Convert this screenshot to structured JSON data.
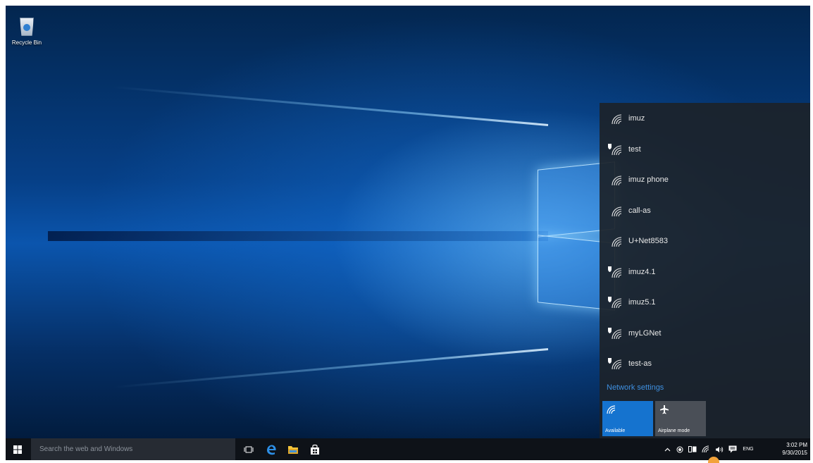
{
  "desktop": {
    "recycle_bin_label": "Recycle Bin"
  },
  "network_flyout": {
    "networks": [
      {
        "name": "imuz",
        "secured": false
      },
      {
        "name": "test",
        "secured": true
      },
      {
        "name": "imuz phone",
        "secured": false
      },
      {
        "name": "call-as",
        "secured": false
      },
      {
        "name": "U+Net8583",
        "secured": false
      },
      {
        "name": "imuz4.1",
        "secured": true
      },
      {
        "name": "imuz5.1",
        "secured": true
      },
      {
        "name": "myLGNet",
        "secured": true
      },
      {
        "name": "test-as",
        "secured": true
      }
    ],
    "settings_link": "Network settings",
    "tiles": {
      "available": {
        "label": "Available",
        "icon": "wifi-icon"
      },
      "airplane": {
        "label": "Airplane mode",
        "icon": "airplane-icon"
      }
    }
  },
  "taskbar": {
    "search_placeholder": "Search the web and Windows",
    "language": "ENG",
    "time": "3:02 PM",
    "date": "9/30/2015"
  },
  "colors": {
    "accent": "#1573cf",
    "link": "#3e8fe0",
    "flyout_bg": "#1c222a",
    "taskbar_bg": "#0e1218"
  }
}
